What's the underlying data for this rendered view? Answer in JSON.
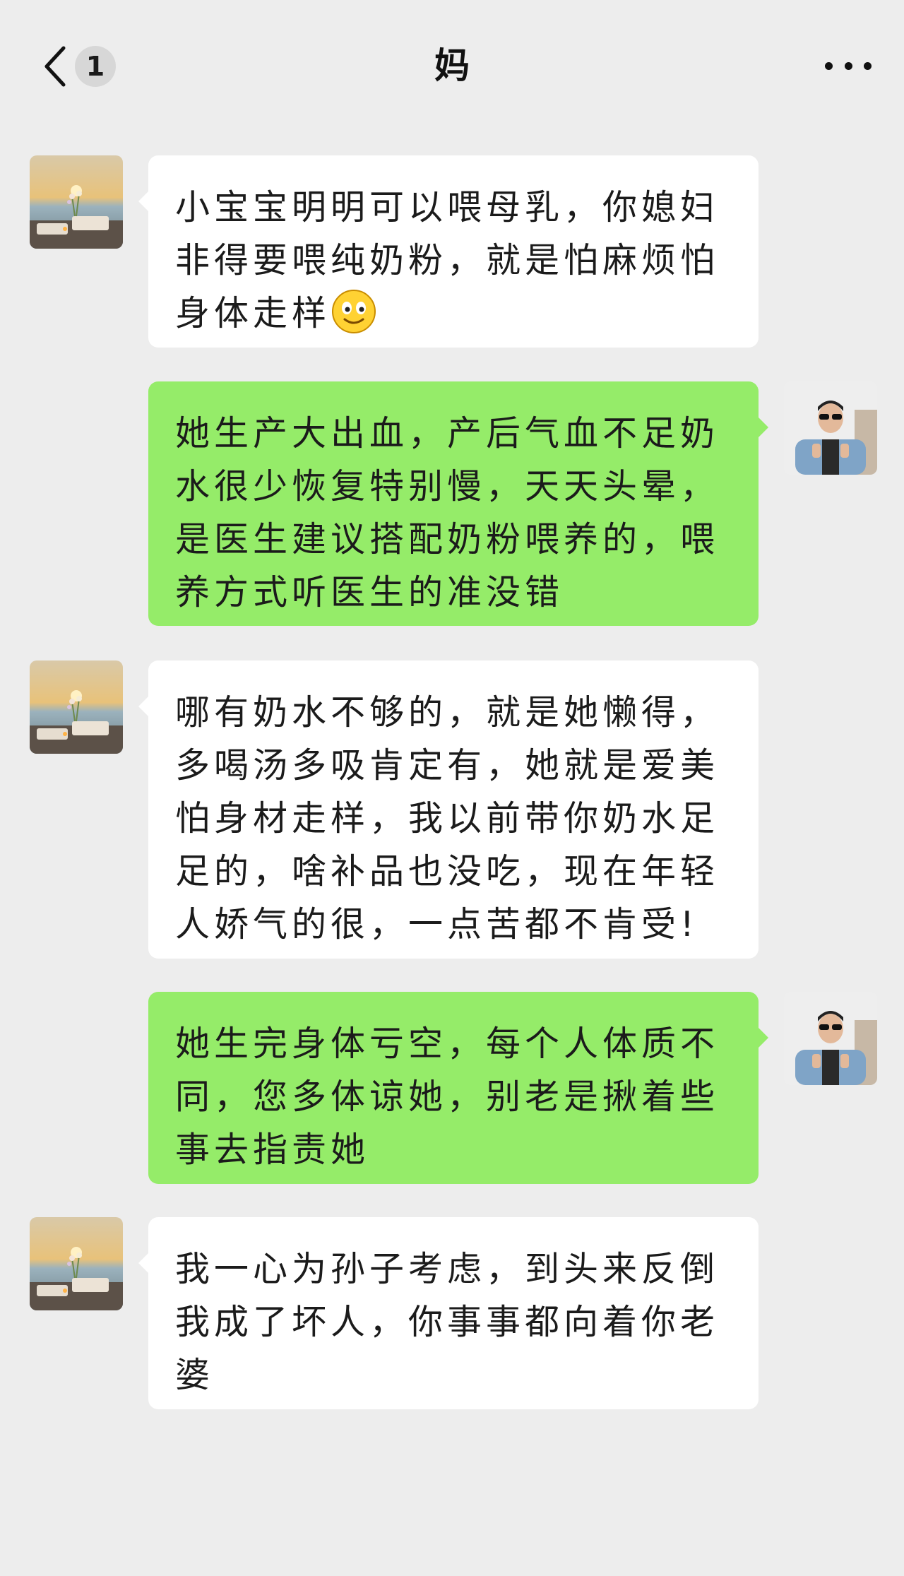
{
  "header": {
    "back_icon": "chevron-left-icon",
    "unread_count": "1",
    "title": "妈",
    "more_icon": "more-dots-icon"
  },
  "messages": [
    {
      "sender": "mom",
      "text_before": "小宝宝明明可以喂母乳，你媳妇非得要喂纯奶粉，就是怕麻烦怕身体走样",
      "emoji": "smiley-icon"
    },
    {
      "sender": "me",
      "text": "她生产大出血，产后气血不足奶水很少恢复特别慢，天天头晕，是医生建议搭配奶粉喂养的，喂养方式听医生的准没错"
    },
    {
      "sender": "mom",
      "text": "哪有奶水不够的，就是她懒得，多喝汤多吸肯定有，她就是爱美怕身材走样，我以前带你奶水足足的，啥补品也没吃，现在年轻人娇气的很，一点苦都不肯受!"
    },
    {
      "sender": "me",
      "text": "她生完身体亏空，每个人体质不同，您多体谅她，别老是揪着些事去指责她"
    },
    {
      "sender": "mom",
      "text": "我一心为孙子考虑，到头来反倒我成了坏人，你事事都向着你老婆"
    }
  ],
  "colors": {
    "background": "#ededed",
    "incoming_bubble": "#ffffff",
    "outgoing_bubble": "#95ec69",
    "badge": "#d7d7d7"
  }
}
